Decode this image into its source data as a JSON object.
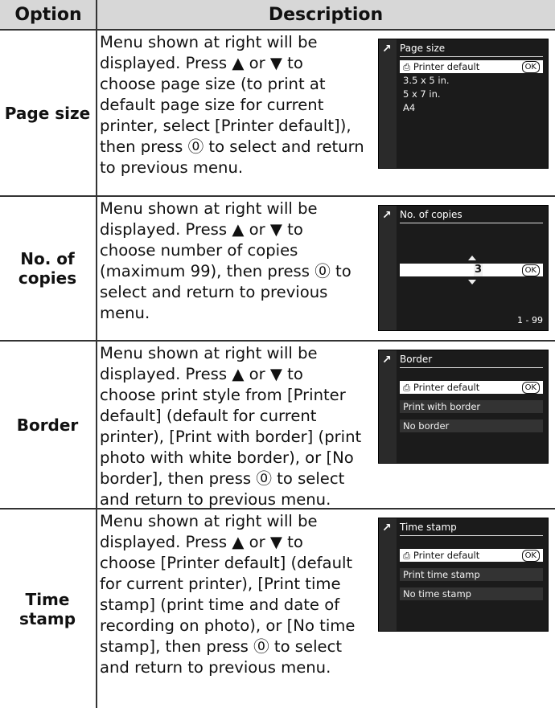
{
  "header": {
    "option": "Option",
    "description": "Description"
  },
  "rows": [
    {
      "option": "Page size",
      "description": "Menu shown at right will be\ndisplayed.  Press ▲ or ▼ to\nchoose page size (to print at\ndefault page size for current\nprinter, select [Printer default]),\nthen press ⓪ to select and return\nto previous menu.",
      "screen": {
        "title": "Page size",
        "items": [
          "Printer default",
          "3.5 x 5 in.",
          "5 x 7 in.",
          "A4"
        ],
        "ok": "OK"
      }
    },
    {
      "option": "No. of\ncopies",
      "description": "Menu shown at right will be\ndisplayed.  Press ▲ or ▼ to\nchoose number of copies\n(maximum 99), then press ⓪ to\nselect and return to previous\nmenu.",
      "screen": {
        "title": "No. of copies",
        "value": "3",
        "ok": "OK",
        "range": "1 - 99"
      }
    },
    {
      "option": "Border",
      "description": "Menu shown at right will be\ndisplayed.  Press ▲ or ▼ to\nchoose print style from [Printer\ndefault] (default for current\nprinter), [Print with border] (print\nphoto with white border), or [No\nborder], then press ⓪ to select\nand return to previous menu.",
      "screen": {
        "title": "Border",
        "items": [
          "Printer default",
          "Print with border",
          "No border"
        ],
        "ok": "OK"
      }
    },
    {
      "option": "Time\nstamp",
      "description": "Menu shown at right will be\ndisplayed.  Press ▲ or ▼ to\nchoose [Printer default] (default\nfor current printer), [Print time\nstamp] (print time and date of\nrecording on photo), or [No time\nstamp], then press ⓪ to select\nand return to previous menu.",
      "screen": {
        "title": "Time stamp",
        "items": [
          "Printer default",
          "Print time stamp",
          "No time stamp"
        ],
        "ok": "OK"
      }
    }
  ]
}
